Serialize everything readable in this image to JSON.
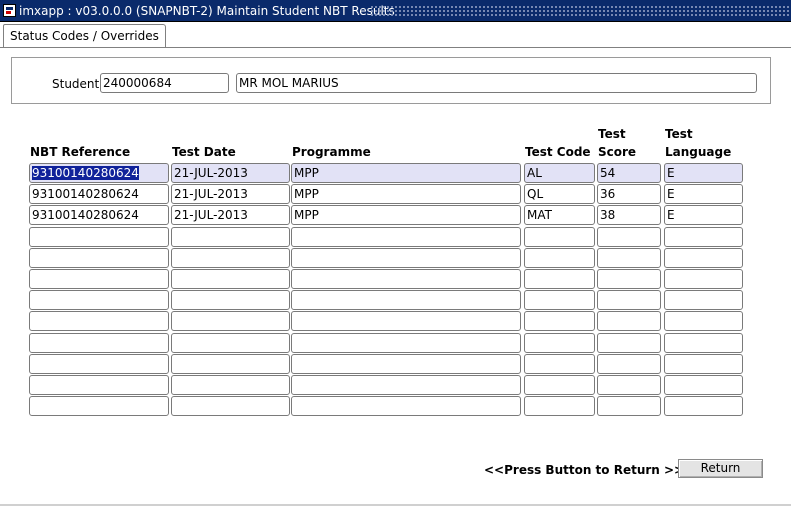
{
  "window": {
    "title": "imxapp : v03.0.0.0  (SNAPNBT-2) Maintain Student NBT Results",
    "icon": "app-icon"
  },
  "tabs": [
    {
      "label": "Status Codes / Overrides",
      "active": true
    }
  ],
  "student": {
    "label": "Student",
    "number": "240000684",
    "name": "MR MOL MARIUS"
  },
  "table": {
    "headers": {
      "nbt_reference": "NBT Reference",
      "test_date": "Test Date",
      "programme": "Programme",
      "test_code": "Test Code",
      "test_score_line1": "Test",
      "test_score_line2": "Score",
      "test_language_line1": "Test",
      "test_language_line2": "Language"
    },
    "rows": [
      {
        "nbt_reference": "93100140280624",
        "test_date": "21-JUL-2013",
        "programme": "MPP",
        "test_code": "AL",
        "test_score": "54",
        "test_language": "E"
      },
      {
        "nbt_reference": "93100140280624",
        "test_date": "21-JUL-2013",
        "programme": "MPP",
        "test_code": "QL",
        "test_score": "36",
        "test_language": "E"
      },
      {
        "nbt_reference": "93100140280624",
        "test_date": "21-JUL-2013",
        "programme": "MPP",
        "test_code": "MAT",
        "test_score": "38",
        "test_language": "E"
      },
      {
        "nbt_reference": "",
        "test_date": "",
        "programme": "",
        "test_code": "",
        "test_score": "",
        "test_language": ""
      },
      {
        "nbt_reference": "",
        "test_date": "",
        "programme": "",
        "test_code": "",
        "test_score": "",
        "test_language": ""
      },
      {
        "nbt_reference": "",
        "test_date": "",
        "programme": "",
        "test_code": "",
        "test_score": "",
        "test_language": ""
      },
      {
        "nbt_reference": "",
        "test_date": "",
        "programme": "",
        "test_code": "",
        "test_score": "",
        "test_language": ""
      },
      {
        "nbt_reference": "",
        "test_date": "",
        "programme": "",
        "test_code": "",
        "test_score": "",
        "test_language": ""
      },
      {
        "nbt_reference": "",
        "test_date": "",
        "programme": "",
        "test_code": "",
        "test_score": "",
        "test_language": ""
      },
      {
        "nbt_reference": "",
        "test_date": "",
        "programme": "",
        "test_code": "",
        "test_score": "",
        "test_language": ""
      },
      {
        "nbt_reference": "",
        "test_date": "",
        "programme": "",
        "test_code": "",
        "test_score": "",
        "test_language": ""
      },
      {
        "nbt_reference": "",
        "test_date": "",
        "programme": "",
        "test_code": "",
        "test_score": "",
        "test_language": ""
      }
    ]
  },
  "footer": {
    "hint": "<<Press Button to Return >>",
    "return_label": "Return"
  },
  "colors": {
    "title_bar": "#0a2a6b",
    "selected_row": "#e2e2f6",
    "selection_highlight": "#10229a"
  }
}
